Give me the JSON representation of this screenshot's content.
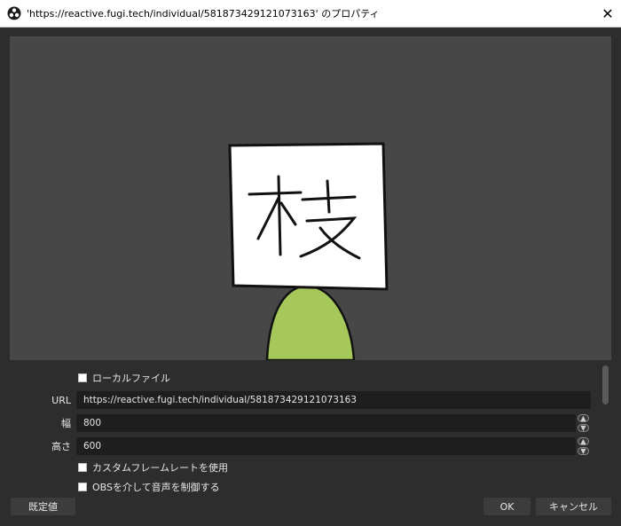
{
  "window": {
    "title": "'https://reactive.fugi.tech/individual/581873429121073163' のプロパティ",
    "close_glyph": "✕"
  },
  "properties": {
    "local_file_label": "ローカルファイル",
    "local_file_checked": false,
    "url_label": "URL",
    "url_value": "https://reactive.fugi.tech/individual/581873429121073163",
    "width_label": "幅",
    "width_value": "800",
    "height_label": "高さ",
    "height_value": "600",
    "custom_fps_label": "カスタムフレームレートを使用",
    "custom_fps_checked": false,
    "audio_control_label": "OBSを介して音声を制御する",
    "audio_control_checked": false
  },
  "buttons": {
    "defaults": "既定値",
    "ok": "OK",
    "cancel": "キャンセル"
  },
  "preview": {
    "sign_character": "枝",
    "body_color": "#a6c85a",
    "sign_color": "#ffffff"
  },
  "icons": {
    "app": "obs-logo-icon",
    "close": "close-icon",
    "spin_up": "chevron-up-icon",
    "spin_down": "chevron-down-icon"
  }
}
